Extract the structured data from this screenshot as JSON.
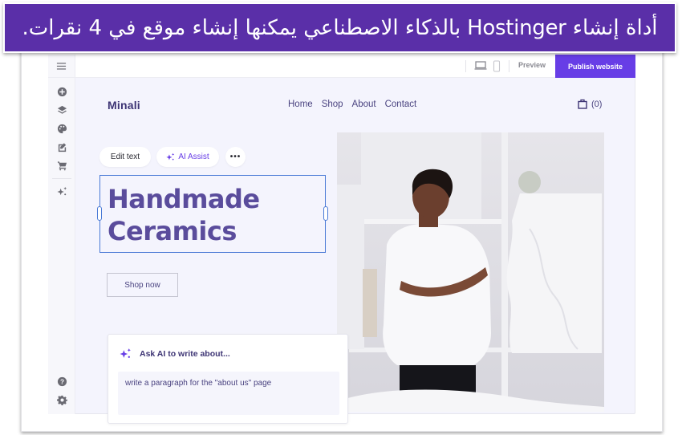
{
  "banner": {
    "text": "أداة إنشاء Hostinger بالذكاء الاصطناعي يمكنها إنشاء موقع في 4 نقرات."
  },
  "toolbar": {
    "preview_label": "Preview",
    "publish_label": "Publish website",
    "devices": [
      "desktop-icon",
      "mobile-icon"
    ]
  },
  "sidebar": {
    "menu_icon": "hamburger-menu-icon",
    "items": [
      {
        "icon": "add-circle-icon",
        "name": "add-section"
      },
      {
        "icon": "layers-icon",
        "name": "layers"
      },
      {
        "icon": "palette-icon",
        "name": "styles"
      },
      {
        "icon": "edit-page-icon",
        "name": "pages"
      },
      {
        "icon": "cart-icon",
        "name": "store"
      },
      {
        "icon": "ai-sparkle-icon",
        "name": "ai-tools"
      }
    ],
    "bottom": [
      {
        "icon": "help-icon",
        "name": "help"
      },
      {
        "icon": "settings-gear-icon",
        "name": "settings"
      }
    ]
  },
  "site": {
    "brand": "Minali",
    "nav": [
      "Home",
      "Shop",
      "About",
      "Contact"
    ],
    "cart_count": "(0)",
    "heading_line1": "Handmade",
    "heading_line2": "Ceramics",
    "cta": "Shop now"
  },
  "text_toolbar": {
    "edit": "Edit text",
    "ai_assist": "AI Assist",
    "more": "•••"
  },
  "ai_card": {
    "title": "Ask AI to write about...",
    "input_value": "write a paragraph for the \"about us\" page"
  },
  "colors": {
    "accent": "#673de6",
    "banner": "#5a2fa8",
    "brand_text": "#3d3474",
    "selection": "#4a7ad6"
  }
}
